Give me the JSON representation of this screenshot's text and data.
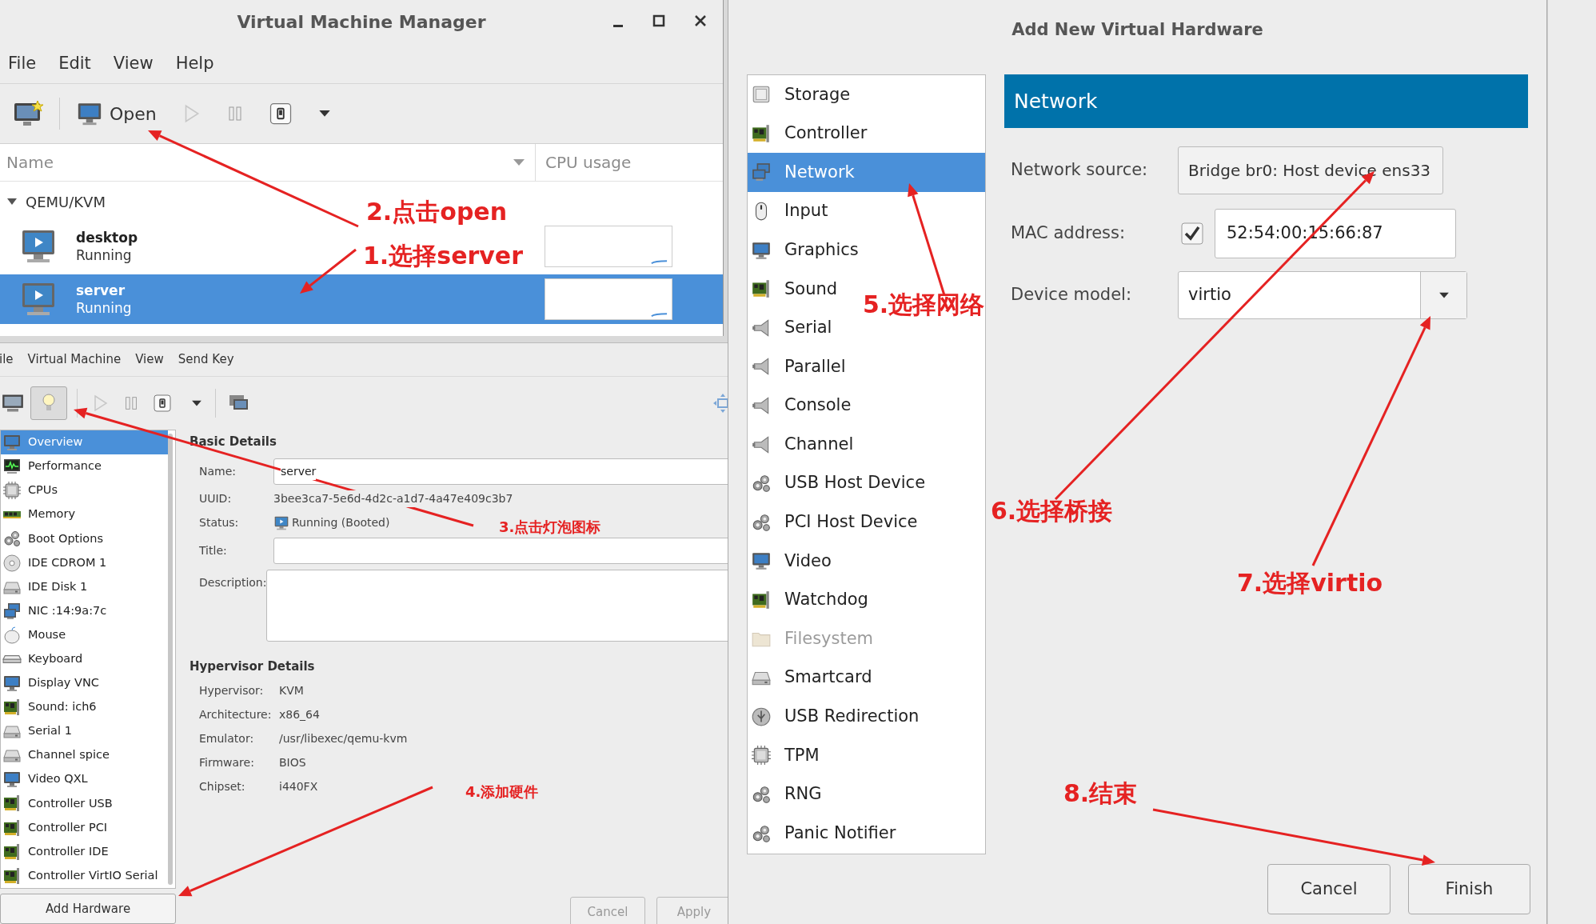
{
  "vmm_window": {
    "title": "Virtual Machine Manager",
    "menu": [
      "File",
      "Edit",
      "View",
      "Help"
    ],
    "toolbar": {
      "open_label": "Open",
      "run_disabled": true
    },
    "columns": [
      "Name",
      "CPU usage"
    ],
    "connection": {
      "name": "QEMU/KVM",
      "expanded": true
    },
    "vms": [
      {
        "name": "desktop",
        "status": "Running",
        "selected": false
      },
      {
        "name": "server",
        "status": "Running",
        "selected": true
      }
    ]
  },
  "details_window": {
    "menu": [
      "ile",
      "Virtual Machine",
      "View",
      "Send Key"
    ],
    "toolbar": {
      "details_selected": true,
      "run_disabled": true
    },
    "sidebar": [
      {
        "label": "Overview",
        "selected": true
      },
      {
        "label": "Performance",
        "selected": false
      },
      {
        "label": "CPUs",
        "selected": false
      },
      {
        "label": "Memory",
        "selected": false
      },
      {
        "label": "Boot Options",
        "selected": false
      },
      {
        "label": "IDE CDROM 1",
        "selected": false
      },
      {
        "label": "IDE Disk 1",
        "selected": false
      },
      {
        "label": "NIC :14:9a:7c",
        "selected": false
      },
      {
        "label": "Mouse",
        "selected": false
      },
      {
        "label": "Keyboard",
        "selected": false
      },
      {
        "label": "Display VNC",
        "selected": false
      },
      {
        "label": "Sound: ich6",
        "selected": false
      },
      {
        "label": "Serial 1",
        "selected": false
      },
      {
        "label": "Channel spice",
        "selected": false
      },
      {
        "label": "Video QXL",
        "selected": false
      },
      {
        "label": "Controller USB",
        "selected": false
      },
      {
        "label": "Controller PCI",
        "selected": false
      },
      {
        "label": "Controller IDE",
        "selected": false
      },
      {
        "label": "Controller VirtIO Serial",
        "selected": false
      }
    ],
    "basic_details": {
      "heading": "Basic Details",
      "fields": [
        {
          "kind": "input",
          "label": "Name:",
          "value": "server"
        },
        {
          "kind": "text",
          "label": "UUID:",
          "value": "3bee3ca7-5e6d-4d2c-a1d7-4a47e409c3b7"
        },
        {
          "kind": "status",
          "label": "Status:",
          "value": "Running (Booted)"
        },
        {
          "kind": "input",
          "label": "Title:"
        },
        {
          "kind": "textarea",
          "label": "Description:"
        }
      ]
    },
    "hypervisor_details": {
      "heading": "Hypervisor Details",
      "fields": [
        {
          "label": "Hypervisor:",
          "value": "KVM"
        },
        {
          "label": "Architecture:",
          "value": "x86_64"
        },
        {
          "label": "Emulator:",
          "value": "/usr/libexec/qemu-kvm"
        },
        {
          "label": "Firmware:",
          "value": "BIOS"
        },
        {
          "label": "Chipset:",
          "value": "i440FX"
        }
      ]
    },
    "add_hardware_button": "Add Hardware",
    "cancel_button": "Cancel",
    "apply_button": "Apply"
  },
  "add_hardware_dialog": {
    "title": "Add New Virtual Hardware",
    "hardware_list": [
      {
        "label": "Storage",
        "selected": false,
        "disabled": false
      },
      {
        "label": "Controller",
        "selected": false,
        "disabled": false
      },
      {
        "label": "Network",
        "selected": true,
        "disabled": false
      },
      {
        "label": "Input",
        "selected": false,
        "disabled": false
      },
      {
        "label": "Graphics",
        "selected": false,
        "disabled": false
      },
      {
        "label": "Sound",
        "selected": false,
        "disabled": false
      },
      {
        "label": "Serial",
        "selected": false,
        "disabled": false
      },
      {
        "label": "Parallel",
        "selected": false,
        "disabled": false
      },
      {
        "label": "Console",
        "selected": false,
        "disabled": false
      },
      {
        "label": "Channel",
        "selected": false,
        "disabled": false
      },
      {
        "label": "USB Host Device",
        "selected": false,
        "disabled": false
      },
      {
        "label": "PCI Host Device",
        "selected": false,
        "disabled": false
      },
      {
        "label": "Video",
        "selected": false,
        "disabled": false
      },
      {
        "label": "Watchdog",
        "selected": false,
        "disabled": false
      },
      {
        "label": "Filesystem",
        "selected": false,
        "disabled": true
      },
      {
        "label": "Smartcard",
        "selected": false,
        "disabled": false
      },
      {
        "label": "USB Redirection",
        "selected": false,
        "disabled": false
      },
      {
        "label": "TPM",
        "selected": false,
        "disabled": false
      },
      {
        "label": "RNG",
        "selected": false,
        "disabled": false
      },
      {
        "label": "Panic Notifier",
        "selected": false,
        "disabled": false
      }
    ],
    "section_title": "Network",
    "network_source": {
      "label": "Network source:",
      "value": "Bridge br0: Host device ens33"
    },
    "mac_address": {
      "label": "MAC address:",
      "checked": true,
      "value": "52:54:00:15:66:87"
    },
    "device_model": {
      "label": "Device model:",
      "value": "virtio"
    },
    "buttons": [
      "Cancel",
      "Finish"
    ]
  },
  "annotations": [
    {
      "text": "2.点击open"
    },
    {
      "text": "1.选择server"
    },
    {
      "text": "3.点击灯泡图标"
    },
    {
      "text": "4.添加硬件"
    },
    {
      "text": "5.选择网络"
    },
    {
      "text": "6.选择桥接"
    },
    {
      "text": "7.选择virtio"
    },
    {
      "text": "8.结束"
    }
  ]
}
